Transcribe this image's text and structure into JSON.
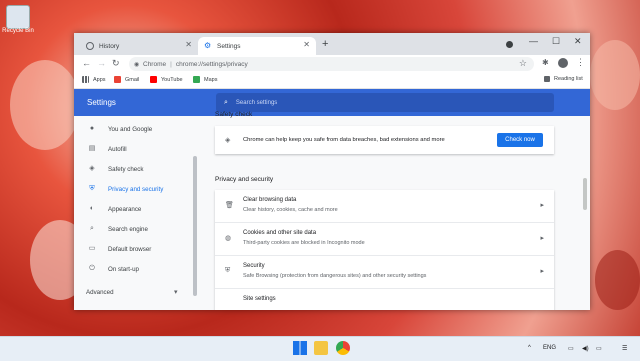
{
  "desktop": {
    "icon_label": "Recycle Bin"
  },
  "browser": {
    "tabs": [
      {
        "label": "History"
      },
      {
        "label": "Settings"
      }
    ],
    "address": {
      "site_label": "Chrome",
      "separator": "|",
      "url": "chrome://settings/privacy"
    },
    "bookmarks": [
      {
        "label": "Apps"
      },
      {
        "label": "Gmail"
      },
      {
        "label": "YouTube"
      },
      {
        "label": "Maps"
      }
    ],
    "reading_list": "Reading list"
  },
  "settings": {
    "title": "Settings",
    "search_placeholder": "Search settings",
    "nav": [
      {
        "label": "You and Google",
        "icon": "person-icon"
      },
      {
        "label": "Autofill",
        "icon": "autofill-icon"
      },
      {
        "label": "Safety check",
        "icon": "shield-check-icon"
      },
      {
        "label": "Privacy and security",
        "icon": "shield-icon"
      },
      {
        "label": "Appearance",
        "icon": "palette-icon"
      },
      {
        "label": "Search engine",
        "icon": "search-icon"
      },
      {
        "label": "Default browser",
        "icon": "browser-icon"
      },
      {
        "label": "On start-up",
        "icon": "power-icon"
      }
    ],
    "advanced": "Advanced",
    "safety_check": {
      "title": "Safety check",
      "text": "Chrome can help keep you safe from data breaches, bad extensions and more",
      "button": "Check now"
    },
    "privacy": {
      "title": "Privacy and security",
      "rows": [
        {
          "title": "Clear browsing data",
          "subtitle": "Clear history, cookies, cache and more"
        },
        {
          "title": "Cookies and other site data",
          "subtitle": "Third-party cookies are blocked in Incognito mode"
        },
        {
          "title": "Security",
          "subtitle": "Safe Browsing (protection from dangerous sites) and other security settings"
        },
        {
          "title": "Site settings",
          "subtitle": ""
        }
      ]
    }
  },
  "taskbar": {
    "lang": "ENG"
  },
  "colors": {
    "accent": "#1a73e8",
    "header": "#3367d6"
  }
}
